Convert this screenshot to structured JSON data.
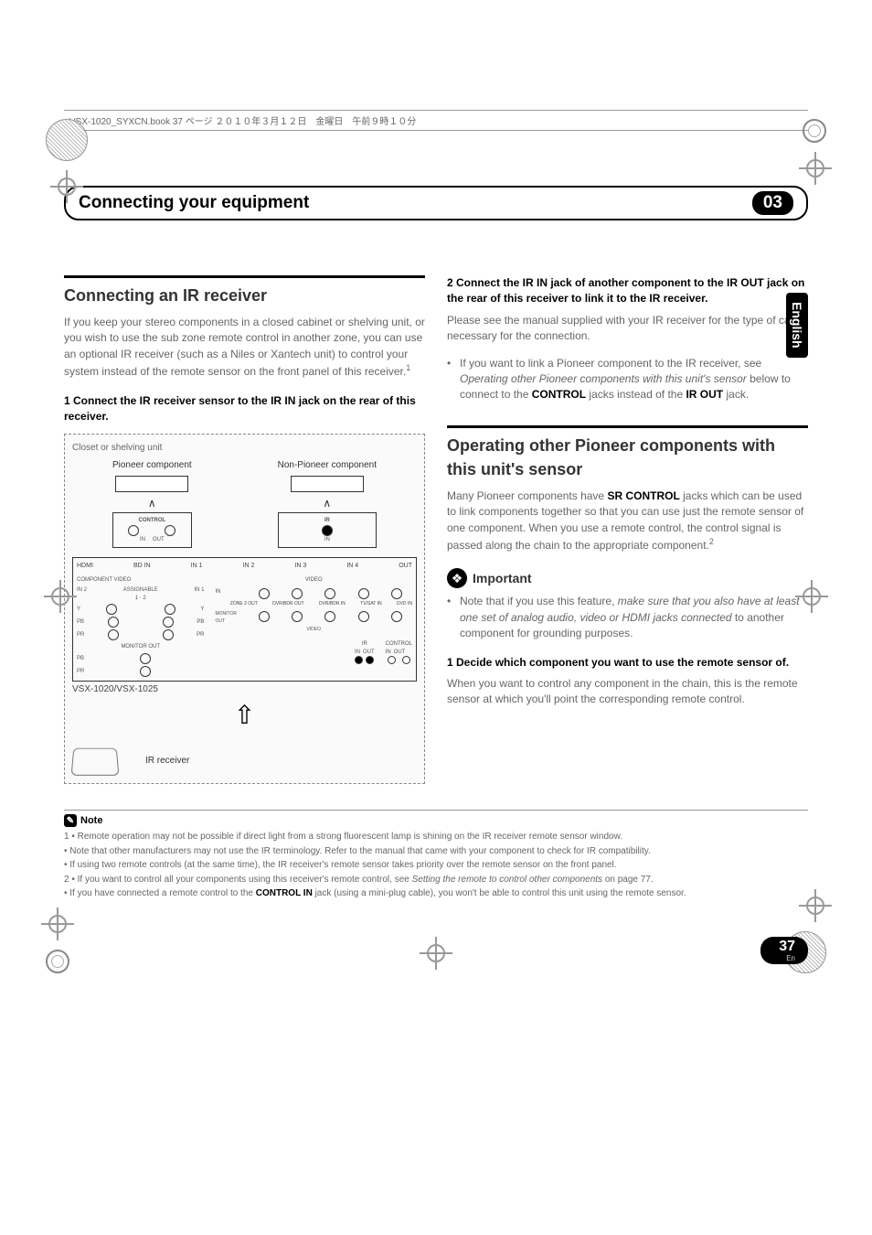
{
  "header_line": "VSX-1020_SYXCN.book  37 ページ  ２０１０年３月１２日　金曜日　午前９時１０分",
  "chapter": {
    "title": "Connecting your equipment",
    "number": "03"
  },
  "lang_tab": "English",
  "left": {
    "section_title": "Connecting an IR receiver",
    "intro_1": "If you keep your stereo components in a closed cabinet or shelving unit, or you wish to use the sub zone remote control in another zone, you can use an optional IR receiver (such as a Niles or Xantech unit) to control your system instead of the remote sensor on the front panel of this receiver.",
    "intro_sup": "1",
    "step1_title": "1    Connect the IR receiver sensor to the IR IN jack on the rear of this receiver.",
    "diagram": {
      "closet": "Closet or shelving unit",
      "pioneer": "Pioneer component",
      "nonpioneer": "Non-Pioneer component",
      "control": "CONTROL",
      "in": "IN",
      "out": "OUT",
      "hdmi": "HDMI",
      "bdin": "BD IN",
      "in1": "IN 1",
      "in2": "IN 2",
      "in3": "IN 3",
      "in4": "IN 4",
      "outlabel": "OUT",
      "compvideo": "COMPONENT VIDEO",
      "video": "VIDEO",
      "monitorout": "MONITOR OUT",
      "monitorout2": "MONITOR OUT",
      "zone2out": "ZONE 2 OUT",
      "dvrbdr_in": "DVR/BDR IN",
      "tvsat_in": "TV/SAT IN",
      "dvd_in": "DVD IN",
      "dvrbdr_out": "DVR/BDR OUT",
      "assignable": "ASSIGNABLE",
      "assign12": "1 · 2",
      "ir": "IR",
      "irin": "IN",
      "irout": "OUT",
      "model": "VSX-1020/VSX-1025",
      "ir_receiver": "IR receiver",
      "y": "Y",
      "pb": "PB",
      "pr": "PR"
    }
  },
  "right": {
    "step2_title": "2    Connect the IR IN jack of another component to the IR OUT jack on the rear of this receiver to link it to the IR receiver.",
    "step2_body": "Please see the manual supplied with your IR receiver for the type of cable necessary for the connection.",
    "bullet1a": "If you want to link a Pioneer component to the IR receiver, see ",
    "bullet1_italic": "Operating other Pioneer components with this unit's sensor",
    "bullet1b": " below to connect to the ",
    "bullet1_bold1": "CONTROL",
    "bullet1c": " jacks instead of the ",
    "bullet1_bold2": "IR OUT",
    "bullet1d": " jack.",
    "section2_title": "Operating other Pioneer components with this unit's sensor",
    "intro2a": "Many Pioneer components have ",
    "intro2_bold": "SR CONTROL",
    "intro2b": " jacks which can be used to link components together so that you can use just the remote sensor of one component. When you use a remote control, the control signal is passed along the chain to the appropriate component.",
    "intro2_sup": "2",
    "important_label": "Important",
    "imp_bullet_a": "Note that if you use this feature, ",
    "imp_bullet_italic": "make sure that you also have at least one set of analog audio, video or HDMI jacks connected",
    "imp_bullet_b": " to another component for grounding purposes.",
    "step1b_title": "1    Decide which component you want to use the remote sensor of.",
    "step1b_body": "When you want to control any component in the chain, this is the remote sensor at which you'll point the corresponding remote control."
  },
  "notes": {
    "title": "Note",
    "n1": "1 • Remote operation may not be possible if direct light from a strong fluorescent lamp is shining on the IR receiver remote sensor window.",
    "n1b": "• Note that other manufacturers may not use the IR terminology. Refer to the manual that came with your component to check for IR compatibility.",
    "n1c": "• If using two remote controls (at the same time), the IR receiver's remote sensor takes priority over the remote sensor on the front panel.",
    "n2a": "2 • If you want to control all your components using this receiver's remote control, see ",
    "n2_italic": "Setting the remote to control other components",
    "n2b": " on page 77.",
    "n2c_a": "• If you have connected a remote control to the ",
    "n2c_bold": "CONTROL IN",
    "n2c_b": " jack (using a mini-plug cable), you won't be able to control this unit using the remote sensor."
  },
  "footer": {
    "page": "37",
    "lang": "En"
  }
}
